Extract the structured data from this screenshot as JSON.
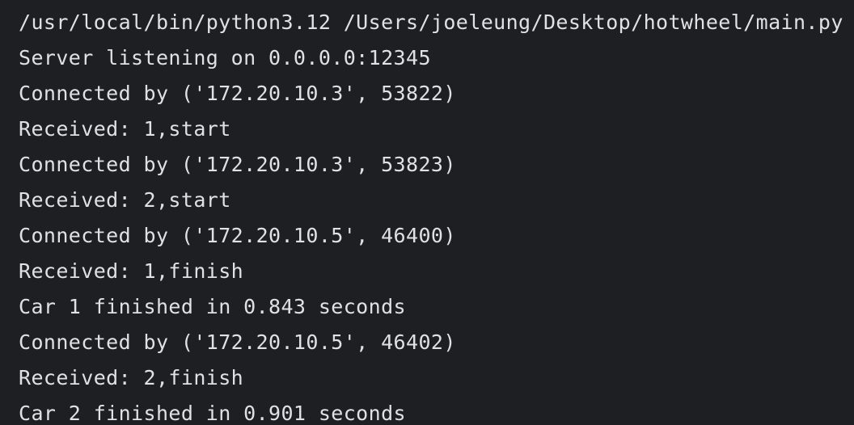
{
  "console": {
    "lines": [
      "/usr/local/bin/python3.12 /Users/joeleung/Desktop/hotwheel/main.py",
      "Server listening on 0.0.0.0:12345",
      "Connected by ('172.20.10.3', 53822)",
      "Received: 1,start",
      "Connected by ('172.20.10.3', 53823)",
      "Received: 2,start",
      "Connected by ('172.20.10.5', 46400)",
      "Received: 1,finish",
      "Car 1 finished in 0.843 seconds",
      "Connected by ('172.20.10.5', 46402)",
      "Received: 2,finish",
      "Car 2 finished in 0.901 seconds"
    ]
  },
  "colors": {
    "background": "#1e1f22",
    "text": "#dfe1e5"
  }
}
